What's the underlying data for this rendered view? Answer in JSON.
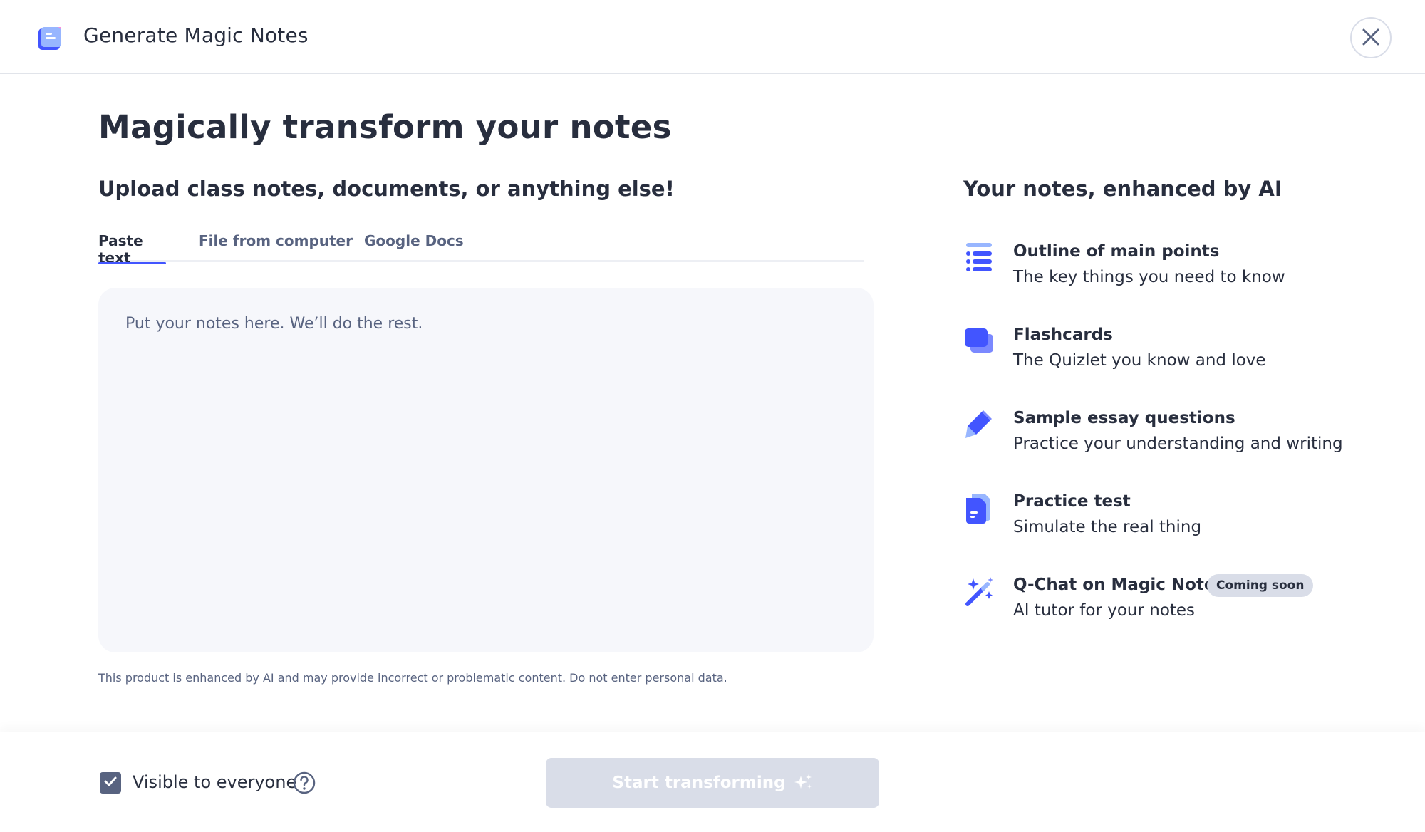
{
  "header": {
    "title": "Generate Magic Notes",
    "logo_icon": "notebook-icon",
    "close_icon": "close-icon"
  },
  "main": {
    "title": "Magically transform your notes",
    "upload_heading": "Upload class notes, documents, or anything else!",
    "tabs": [
      {
        "label": "Paste text",
        "active": true
      },
      {
        "label": "File from computer",
        "active": false
      },
      {
        "label": "Google Docs",
        "active": false
      }
    ],
    "notes_input": {
      "placeholder": "Put your notes here. We’ll do the rest.",
      "value": ""
    },
    "disclaimer": "This product is enhanced by AI and may provide incorrect or problematic content. Do not enter personal data."
  },
  "features": {
    "heading": "Your notes, enhanced by AI",
    "items": [
      {
        "icon": "list-outline-icon",
        "title": "Outline of main points",
        "description": "The key things you need to know"
      },
      {
        "icon": "flashcards-icon",
        "title": "Flashcards",
        "description": "The Quizlet you know and love"
      },
      {
        "icon": "pencil-icon",
        "title": "Sample essay questions",
        "description": "Practice your understanding and writing"
      },
      {
        "icon": "document-stack-icon",
        "title": "Practice test",
        "description": "Simulate the real thing"
      },
      {
        "icon": "magic-wand-sparkle-icon",
        "title": "Q-Chat on Magic Notes",
        "description": "AI tutor for your notes",
        "badge": "Coming soon"
      }
    ]
  },
  "footer": {
    "visibility_checked": true,
    "visibility_label": "Visible to everyone",
    "help_icon": "question-circle-icon",
    "start_button_label": "Start transforming",
    "start_button_icon": "sparkle-icon",
    "start_button_disabled": true
  },
  "colors": {
    "accent": "#4255ff",
    "text": "#282e3e",
    "muted": "#586380",
    "input_bg": "#f6f7fb",
    "disabled_bg": "#d9dde8"
  }
}
